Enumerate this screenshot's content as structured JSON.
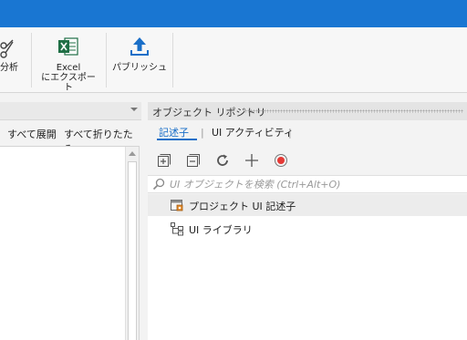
{
  "ribbon": {
    "items": [
      {
        "label": "分析"
      },
      {
        "label": "Excel\nにエクスポート"
      },
      {
        "label": "パブリッシュ"
      }
    ]
  },
  "left_panel": {
    "expand_all": "すべて展開",
    "collapse_all": "すべて折りたたみ"
  },
  "object_repository": {
    "title": "オブジェクト リポジトリ",
    "tabs": [
      {
        "label": "記述子",
        "active": true
      },
      {
        "label": "UI アクティビティ",
        "active": false
      }
    ],
    "tab_separator": "|",
    "toolbar_icons": [
      "expand-all-icon",
      "collapse-all-icon",
      "refresh-icon",
      "add-icon",
      "record-icon"
    ],
    "search": {
      "placeholder": "UI オブジェクトを検索 (Ctrl+Alt+O)",
      "value": ""
    },
    "tree": [
      {
        "label": "プロジェクト UI 記述子",
        "icon": "project-descriptors-icon",
        "selected": true
      },
      {
        "label": "UI ライブラリ",
        "icon": "ui-library-icon",
        "selected": false
      }
    ]
  },
  "colors": {
    "titlebar": "#1976d2",
    "accent": "#1a6fc8",
    "excel_green": "#1f6f45",
    "record_red": "#e53935"
  }
}
